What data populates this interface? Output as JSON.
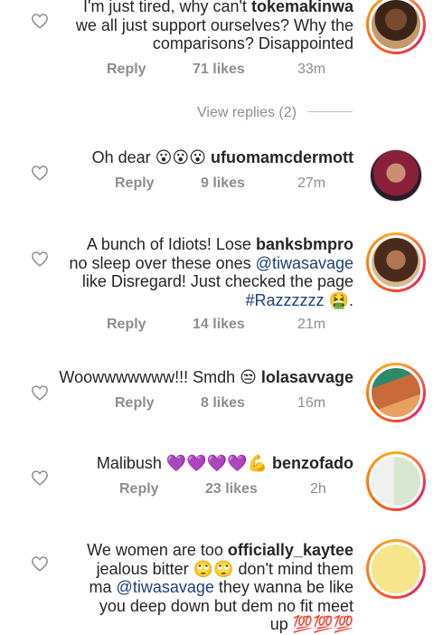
{
  "comments": [
    {
      "lines": [
        "I'm just tired, why can't",
        "we all just support ourselves? Why the",
        "comparisons? Disappointed"
      ],
      "username": "tokemakinwa",
      "reply_label": "Reply",
      "likes": "71 likes",
      "time": "33m"
    },
    {
      "text": "Oh dear",
      "emoji": "😮😮😮",
      "username": "ufuomamcdermott",
      "reply_label": "Reply",
      "likes": "9 likes",
      "time": "27m"
    },
    {
      "line1": "A bunch of Idiots! Lose",
      "username": "banksbmpro",
      "line2a": "no sleep over these ones",
      "mention": "@tiwasavage",
      "line3": "like Disregard! Just checked the page",
      "hashtag": "#Razzzzzz",
      "emoji": "🤮",
      "end": ".",
      "reply_label": "Reply",
      "likes": "14 likes",
      "time": "21m"
    },
    {
      "text": "Woowwwwwww!!! Smdh",
      "emoji": "😒",
      "username": "lolasavvage",
      "reply_label": "Reply",
      "likes": "8 likes",
      "time": "16m"
    },
    {
      "text": "Malibush",
      "emoji": "💜💜💜💜💪",
      "username": "benzofado",
      "reply_label": "Reply",
      "likes": "23 likes",
      "time": "2h"
    },
    {
      "line1": "We women are too",
      "username": "officially_kaytee",
      "line2a": "jealous bitter",
      "emoji_a": "🙄🙄",
      "line2b": "don't mind them",
      "line3a": "ma",
      "mention": "@tiwasavage",
      "line3b": "they wanna be like",
      "line4": "you deep down but dem no fit  meet",
      "line5": "up",
      "emoji_b": "💯💯💯"
    }
  ],
  "view_replies": "View replies (2)"
}
